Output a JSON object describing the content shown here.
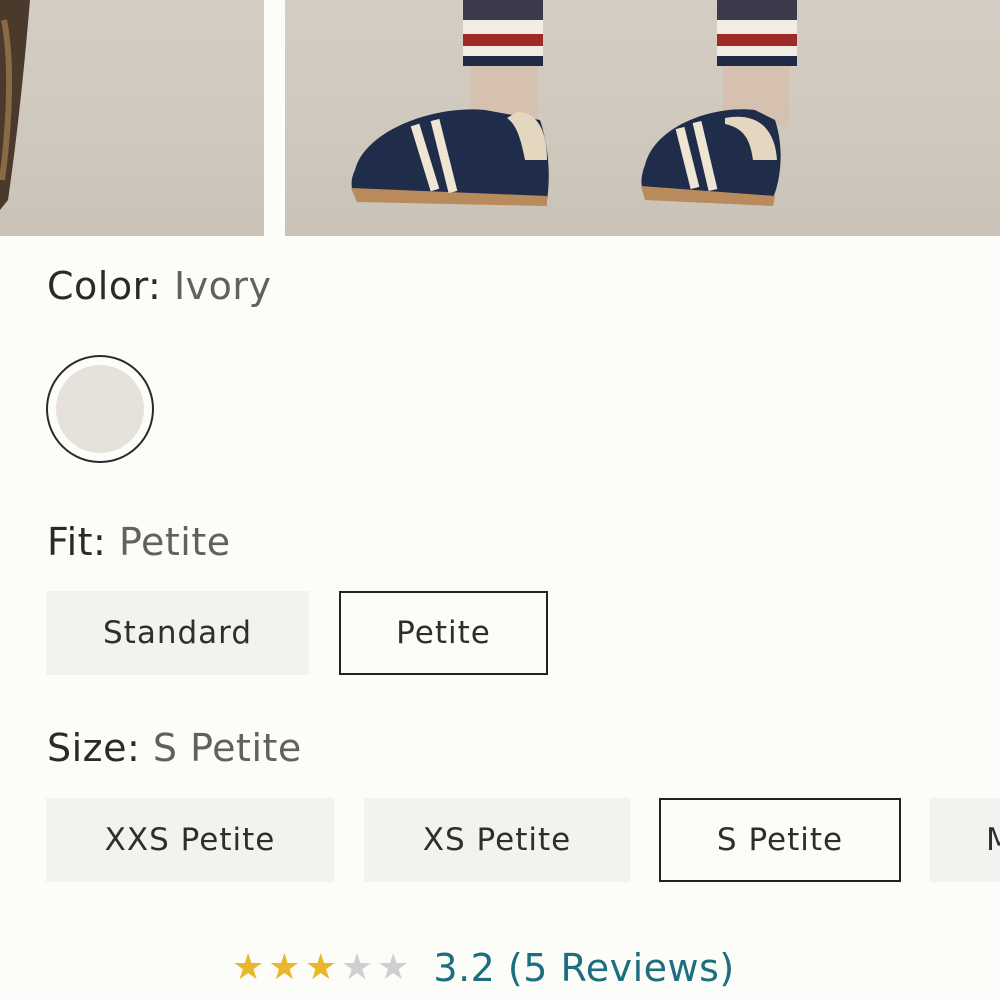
{
  "product": {
    "color": {
      "label": "Color:",
      "value": "Ivory",
      "swatch_color": "#e6e2db"
    },
    "fit": {
      "label": "Fit:",
      "value": "Petite",
      "options": [
        "Standard",
        "Petite"
      ]
    },
    "size": {
      "label": "Size:",
      "value": "S Petite",
      "options": [
        "XXS Petite",
        "XS Petite",
        "S Petite",
        "M"
      ]
    },
    "rating": {
      "stars_filled": 3,
      "stars_total": 5,
      "text": "3.2 (5 Reviews)"
    }
  },
  "colors": {
    "star_filled": "#e8b72a",
    "star_empty": "#cfcfcf",
    "link": "#1d6e7e"
  }
}
